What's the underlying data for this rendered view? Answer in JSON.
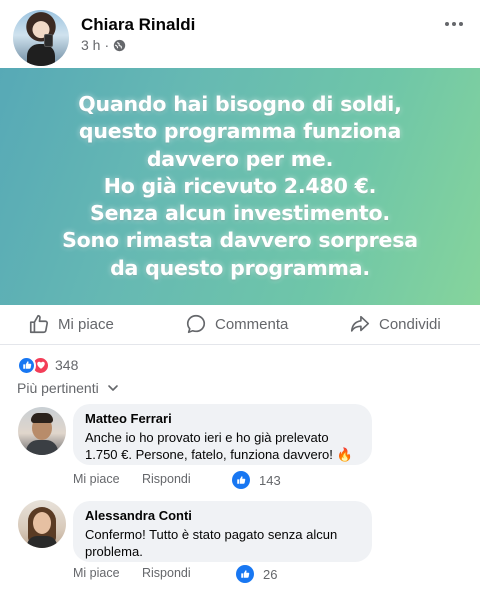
{
  "post": {
    "author": "Chiara Rinaldi",
    "time": "3 h",
    "separator": "·",
    "text_lines": [
      "Quando hai bisogno di soldi,",
      "questo programma funziona",
      "davvero per me.",
      "Ho già ricevuto 2.480 €.",
      "Senza alcun investimento.",
      "Sono rimasta davvero sorpresa",
      "da questo programma."
    ]
  },
  "actions": {
    "like": "Mi piace",
    "comment": "Commenta",
    "share": "Condividi"
  },
  "reactions": {
    "count": "348",
    "icons": [
      "like-icon",
      "love-icon"
    ]
  },
  "sort": {
    "label": "Più pertinenti"
  },
  "comments": [
    {
      "author": "Matteo Ferrari",
      "text": "Anche io ho provato ieri e ho già prelevato 1.750 €. Persone, fatelo, funziona davvero! 🔥",
      "like_label": "Mi piace",
      "reply_label": "Rispondi",
      "likes": "143"
    },
    {
      "author": "Alessandra Conti",
      "text": "Confermo! Tutto è stato pagato senza alcun problema.",
      "like_label": "Mi piace",
      "reply_label": "Rispondi",
      "likes": "26"
    }
  ],
  "colors": {
    "brand_blue": "#1877f2",
    "love_red": "#f33e58",
    "secondary_text": "#65676b",
    "bubble_bg": "#f0f2f5"
  }
}
